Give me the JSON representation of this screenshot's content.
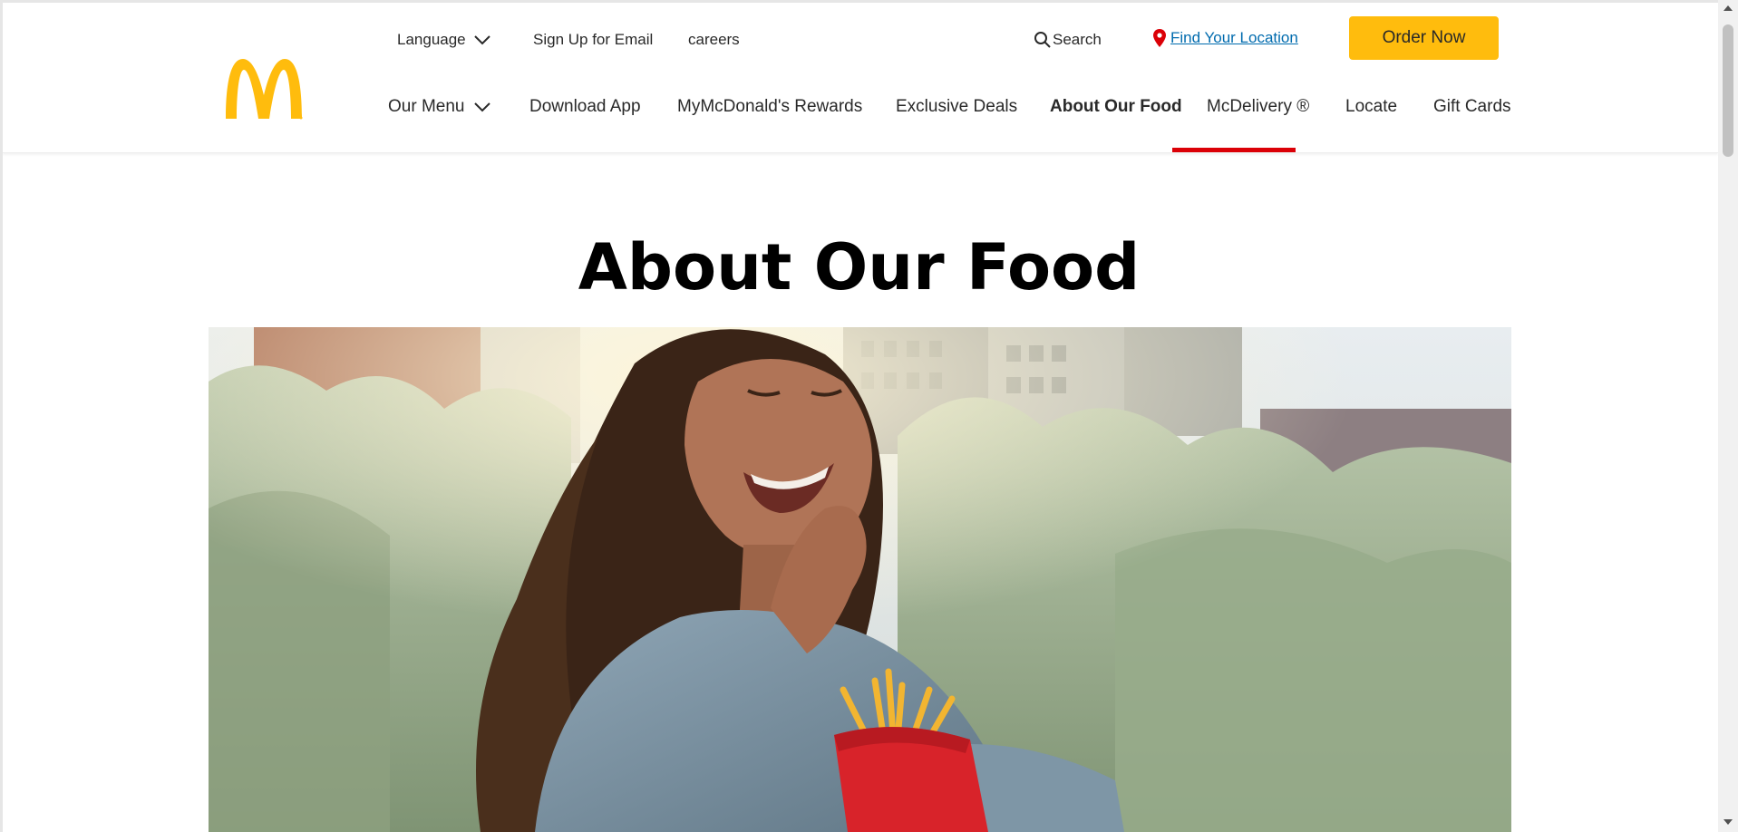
{
  "header": {
    "logo_icon": "golden-arches-logo",
    "utility_nav": {
      "language_label": "Language",
      "signup_label": "Sign Up for Email",
      "careers_label": "careers",
      "search_label": "Search",
      "location_label": "Find Your Location"
    },
    "order_button_label": "Order Now",
    "main_nav": [
      {
        "label": "Our Menu"
      },
      {
        "label": "Download App"
      },
      {
        "label": "MyMcDonald's Rewards"
      },
      {
        "label": "Exclusive Deals"
      },
      {
        "label": "About Our Food"
      },
      {
        "label": "McDelivery ®"
      },
      {
        "label": "Locate"
      },
      {
        "label": "Gift Cards"
      }
    ],
    "active_nav": "About Our Food"
  },
  "main": {
    "title": "About Our Food",
    "hero_image": "woman-eating-fries-photo"
  },
  "colors": {
    "brand_yellow": "#ffbc0d",
    "brand_red": "#db0007",
    "link_blue": "#006bae",
    "text": "#292929"
  }
}
